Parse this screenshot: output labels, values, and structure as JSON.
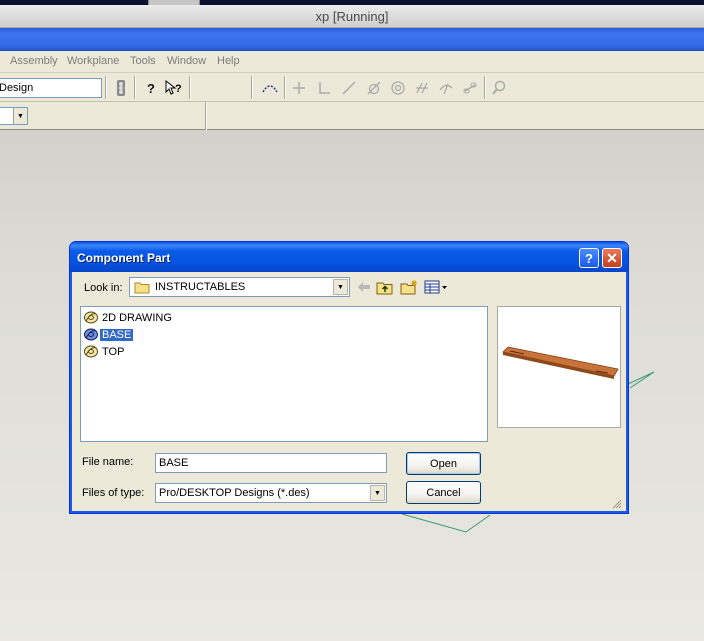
{
  "host": {
    "title": "xp [Running]"
  },
  "menubar": {
    "items": [
      "Assembly",
      "Workplane",
      "Tools",
      "Window",
      "Help"
    ]
  },
  "toolbar": {
    "mode_value": "Design"
  },
  "dialog": {
    "title": "Component Part",
    "look_in_label": "Look in:",
    "look_in_value": "INSTRUCTABLES",
    "files": [
      {
        "name": "2D DRAWING",
        "selected": false
      },
      {
        "name": "BASE",
        "selected": true
      },
      {
        "name": "TOP",
        "selected": false
      }
    ],
    "file_name_label": "File name:",
    "file_name_value": "BASE",
    "files_of_type_label": "Files of type:",
    "files_of_type_value": "Pro/DESKTOP Designs (*.des)",
    "open_label": "Open",
    "cancel_label": "Cancel",
    "help_symbol": "?",
    "close_symbol": "✕"
  },
  "colors": {
    "xp_blue": "#0553e1",
    "selection": "#316ac5",
    "workplane_line": "#3a9a72",
    "part_wood": "#c8733a"
  }
}
